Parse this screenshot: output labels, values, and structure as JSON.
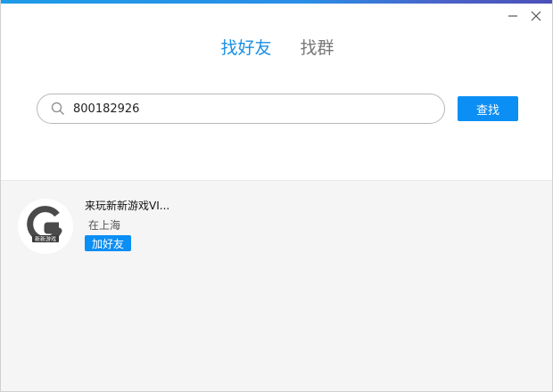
{
  "window": {
    "minimize_icon": "minimize-icon",
    "close_icon": "close-icon"
  },
  "tabs": [
    {
      "label": "找好友",
      "active": true
    },
    {
      "label": "找群",
      "active": false
    }
  ],
  "search": {
    "icon": "search-icon",
    "value": "800182926",
    "button_label": "查找"
  },
  "results": [
    {
      "name": "来玩新新游戏VI...",
      "location": "在上海",
      "add_label": "加好友",
      "avatar_logo_text": "新新游戏"
    }
  ],
  "colors": {
    "accent": "#0b8ff5",
    "tab_active": "#1a8fe3",
    "results_bg": "#f5f5f5"
  }
}
